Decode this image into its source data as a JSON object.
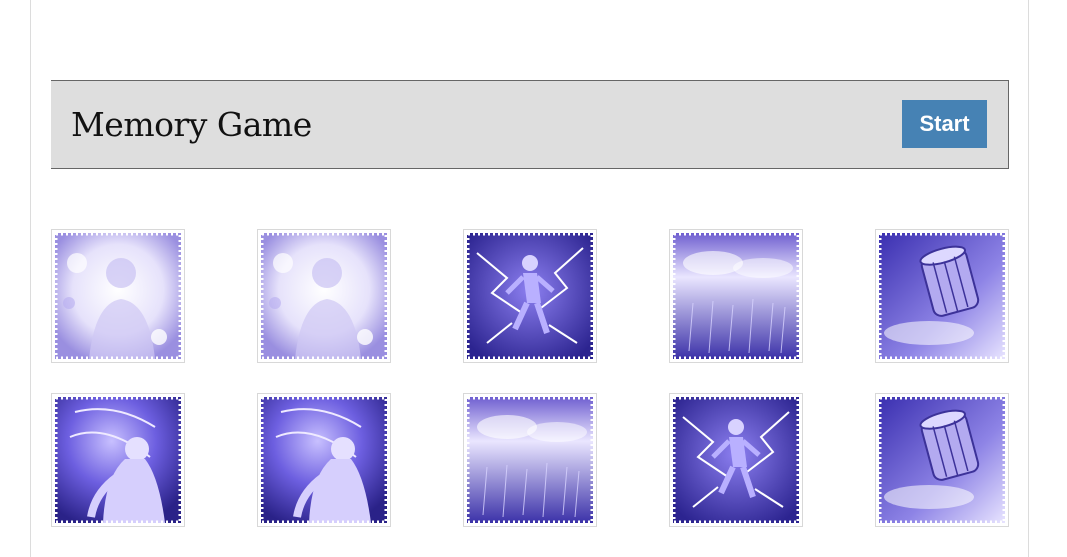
{
  "header": {
    "title": "Memory Game",
    "start_label": "Start"
  },
  "colors": {
    "button": "#4682b4",
    "header_bg": "#dedede",
    "card_tint": "#5a4ec8"
  },
  "board": {
    "columns": 5,
    "rows": 2,
    "cards": [
      {
        "image": "faded-man-portrait-icon"
      },
      {
        "image": "faded-man-portrait-icon"
      },
      {
        "image": "lightning-figure-icon"
      },
      {
        "image": "rain-storm-icon"
      },
      {
        "image": "flying-barrel-icon"
      },
      {
        "image": "crouching-man-aura-icon"
      },
      {
        "image": "crouching-man-aura-icon"
      },
      {
        "image": "rain-storm-icon"
      },
      {
        "image": "lightning-figure-icon"
      },
      {
        "image": "flying-barrel-icon"
      }
    ]
  }
}
